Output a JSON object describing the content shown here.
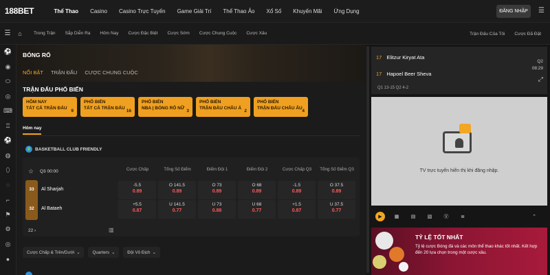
{
  "brand": {
    "logo_text": "188BET"
  },
  "nav": {
    "items": [
      "Thể Thao",
      "Casino",
      "Casino Trực Tuyến",
      "Game Giải Trí",
      "Thể Thao Ảo",
      "Xổ Số",
      "Khuyến Mãi",
      "Ứng Dụng"
    ],
    "active": "Thể Thao",
    "login_label": "ĐĂNG NHẬP"
  },
  "subnav": {
    "items": [
      "Trong Trận",
      "Sắp Diễn Ra",
      "Hôm Nay",
      "Cược Đặc Biệt",
      "Cược Sớm",
      "Cược Chung Cuộc",
      "Cược Xâu"
    ],
    "right_items": [
      "Trận Đấu Của Tôi",
      "Cược Đã Đặt"
    ]
  },
  "sidebar": {
    "icons": [
      "soccer-icon",
      "basketball-icon",
      "football-icon",
      "tennis-icon",
      "esports-icon",
      "trophy-icon",
      "soccer-icon",
      "volleyball-icon",
      "rugby-icon",
      "baseball-icon",
      "hockey-icon",
      "golf-icon",
      "cycling-icon",
      "darts-icon",
      "table-tennis-icon"
    ]
  },
  "main": {
    "hero_title": "BÓNG RỔ",
    "tabs": [
      "NỔI BẬT",
      "TRẬN ĐẤU",
      "CƯỢC CHUNG CUỘC"
    ],
    "active_tab": "NỔI BẬT",
    "section_title": "TRẬN ĐẤU PHỔ BIẾN",
    "cards": [
      {
        "l1": "HÔM NAY",
        "l2": "TẤT CẢ TRẬN ĐẤU",
        "count": "9"
      },
      {
        "l1": "PHỔ BIẾN",
        "l2": "TẤT CẢ TRẬN ĐẤU",
        "count": "16"
      },
      {
        "l1": "PHỔ BIẾN",
        "l2": "NBA | BÓNG RỔ NỮ",
        "count": "3"
      },
      {
        "l1": "PHỔ BIẾN",
        "l2": "TRẬN ĐẤU CHÂU Á",
        "count": "2"
      },
      {
        "l1": "PHỔ BIẾN",
        "l2": "TRẬN ĐẤU CHÂU ÂU",
        "count": "4"
      }
    ],
    "day_tab": "Hôm nay",
    "league_name": "BASKETBALL CLUB FRIENDLY",
    "match": {
      "time": "Q3 00:00",
      "columns": [
        "Cược Chấp",
        "Tổng Số Điểm",
        "Điểm Đội 1",
        "Điểm Đội 2",
        "Cược Chấp Q3",
        "Tổng Số Điểm Q3"
      ],
      "teams": [
        {
          "score": "33",
          "name": "Al Sharjah",
          "odds": [
            [
              "-5.5",
              "0.89"
            ],
            [
              "O 141.5",
              "0.89"
            ],
            [
              "O 73",
              "0.89"
            ],
            [
              "O 68",
              "0.89"
            ],
            [
              "-1.5",
              "0.89"
            ],
            [
              "O 37.5",
              "0.89"
            ]
          ]
        },
        {
          "score": "32",
          "name": "Al Bataeh",
          "odds": [
            [
              "+5.5",
              "0.87"
            ],
            [
              "U 141.5",
              "0.77"
            ],
            [
              "U 73",
              "0.88"
            ],
            [
              "U 68",
              "0.77"
            ],
            [
              "+1.5",
              "0.87"
            ],
            [
              "U 37.5",
              "0.77"
            ]
          ]
        }
      ],
      "more_count": "22",
      "more_arrow": "›"
    },
    "filters": [
      "Cược Chấp & Trên/Dưới",
      "Quarters",
      "Đội Vô Địch"
    ]
  },
  "live": {
    "rows": [
      {
        "score": "17",
        "team": "Elitzur Kiryat Ata"
      },
      {
        "score": "17",
        "team": "Hapoel Beer Sheva"
      }
    ],
    "quarter": "Q2",
    "clock": "08:29",
    "period_scores": "Q1 13-15  Q2 4-2"
  },
  "tv": {
    "message": "TV trực tuyến hiển thị khi đăng nhập."
  },
  "promo": {
    "title": "TỶ LỆ TỐT NHẤT",
    "text": "Tỷ lệ cược Bóng đá và các môn thể thao khác tốt nhất. Kết hợp đến 20 lựa chọn trong một cược xâu."
  },
  "colors": {
    "accent": "#f2a622",
    "odds_red": "#ff5b5b",
    "promo_bg": "#8a1533"
  }
}
